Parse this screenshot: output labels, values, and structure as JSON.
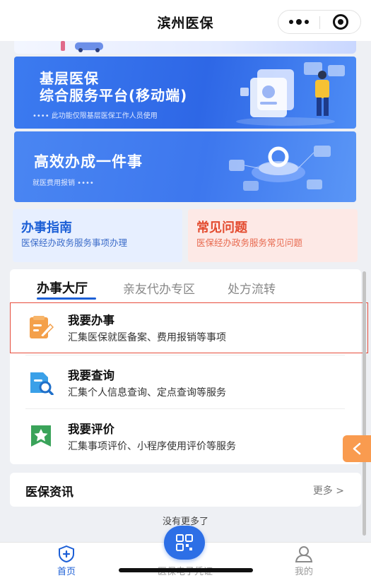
{
  "header": {
    "title": "滨州医保"
  },
  "banners": [
    {
      "title_line1": "基层医保",
      "title_line2": "综合服务平台(移动端)",
      "subtitle": "•••• 此功能仅限基层医保工作人员使用"
    },
    {
      "title_line1": "高效办成一件事",
      "subtitle": "就医费用报销 ••••"
    }
  ],
  "cards": {
    "guide": {
      "title": "办事指南",
      "subtitle": "医保经办政务服务事项办理"
    },
    "faq": {
      "title": "常见问题",
      "subtitle": "医保经办政务服务常见问题"
    }
  },
  "hall": {
    "tabs": [
      "办事大厅",
      "亲友代办专区",
      "处方流转"
    ],
    "active_tab": "办事大厅",
    "services": [
      {
        "title": "我要办事",
        "subtitle": "汇集医保就医备案、费用报销等事项",
        "icon": "edit-document-icon"
      },
      {
        "title": "我要查询",
        "subtitle": "汇集个人信息查询、定点查询等服务",
        "icon": "search-document-icon"
      },
      {
        "title": "我要评价",
        "subtitle": "汇集事项评价、小程序使用评价等服务",
        "icon": "star-badge-icon"
      }
    ]
  },
  "news": {
    "title": "医保资讯",
    "more_label": "更多 >"
  },
  "footer_text": "没有更多了",
  "tabbar": {
    "home": "首页",
    "card": "医保电子凭证",
    "mine": "我的"
  },
  "colors": {
    "primary": "#1c5fd6",
    "accent_orange": "#f99b4f",
    "faq_red": "#e34b2f",
    "highlight_frame": "#e74c3c"
  }
}
